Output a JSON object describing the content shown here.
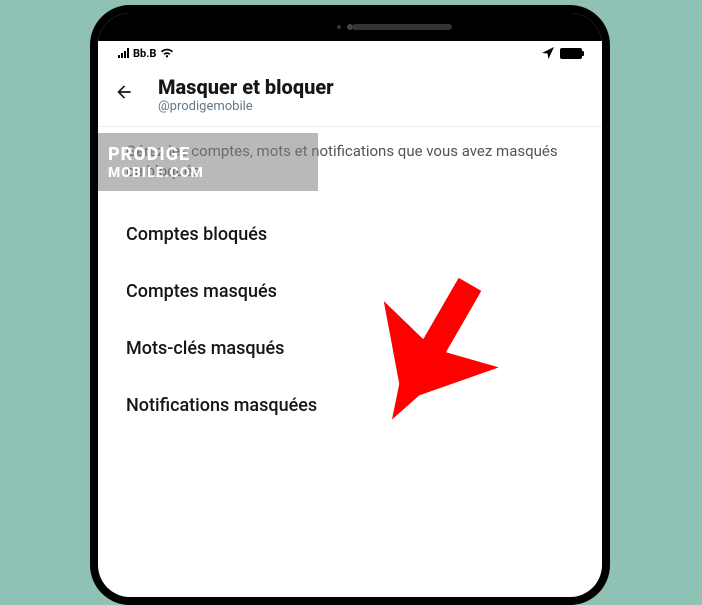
{
  "status_bar": {
    "carrier": "Bb.B"
  },
  "header": {
    "title": "Masquer et bloquer",
    "handle": "@prodigemobile"
  },
  "description": "Gérez les comptes, mots et notifications que vous avez masqués ou bloqués.",
  "watermark": {
    "line1": "PRODIGE",
    "line2": "MOBILE.COM"
  },
  "menu": {
    "items": [
      {
        "label": "Comptes bloqués"
      },
      {
        "label": "Comptes masqués"
      },
      {
        "label": "Mots-clés masqués"
      },
      {
        "label": "Notifications masquées"
      }
    ]
  }
}
